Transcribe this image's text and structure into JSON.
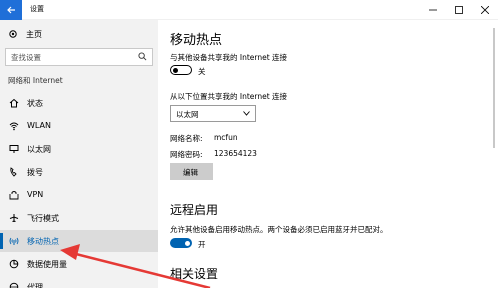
{
  "window": {
    "title": "设置"
  },
  "sidebar": {
    "home_label": "主页",
    "search_placeholder": "查找设置",
    "section_label": "网络和 Internet",
    "items": [
      {
        "label": "状态",
        "icon": "home-status-icon"
      },
      {
        "label": "WLAN",
        "icon": "wifi-icon"
      },
      {
        "label": "以太网",
        "icon": "ethernet-icon"
      },
      {
        "label": "拨号",
        "icon": "dialup-icon"
      },
      {
        "label": "VPN",
        "icon": "vpn-icon"
      },
      {
        "label": "飞行模式",
        "icon": "airplane-icon"
      },
      {
        "label": "移动热点",
        "icon": "hotspot-icon",
        "active": true
      },
      {
        "label": "数据使用量",
        "icon": "data-usage-icon"
      },
      {
        "label": "代理",
        "icon": "proxy-icon"
      }
    ]
  },
  "main": {
    "title": "移动热点",
    "share_label": "与其他设备共享我的 Internet 连接",
    "share_toggle": {
      "state": "off",
      "label": "关"
    },
    "source_label": "从以下位置共享我的 Internet 连接",
    "source_value": "以太网",
    "network_name_key": "网络名称:",
    "network_name_val": "mcfun",
    "password_key": "网络密码:",
    "password_val": "123654123",
    "edit_label": "编辑",
    "remote_title": "远程启用",
    "remote_desc": "允许其他设备启用移动热点。两个设备必须已启用蓝牙并已配对。",
    "remote_toggle": {
      "state": "on",
      "label": "开"
    },
    "related_title": "相关设置"
  },
  "colors": {
    "accent": "#0063b1",
    "back_button": "#1f6fd8",
    "sidebar_bg": "#f2f2f2",
    "arrow": "#e53935"
  }
}
